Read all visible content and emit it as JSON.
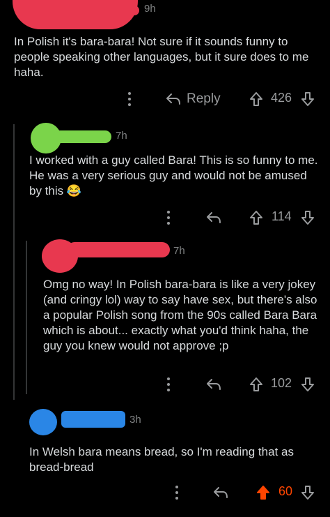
{
  "comments": [
    {
      "time": "9h",
      "body": "In Polish it's bara-bara! Not sure if it sounds funny to people speaking other languages, but it sure does to me haha.",
      "reply_label": "Reply",
      "score": "426",
      "redaction_color": "#e8384f",
      "upvoted": false
    },
    {
      "time": "7h",
      "body": "I worked with a guy called Bara! This is so funny to me. He was a very serious guy and would not be amused by this",
      "emoji": "😂",
      "score": "114",
      "redaction_color": "#7bd44a",
      "upvoted": false
    },
    {
      "time": "7h",
      "body": "Omg no way! In Polish bara-bara is like a very jokey (and cringy lol) way to say have sex, but there's also a popular Polish song from the 90s called Bara Bara which is about... exactly what you'd think haha, the guy you knew would not approve ;p",
      "score": "102",
      "redaction_color": "#e8384f",
      "upvoted": false
    },
    {
      "time": "3h",
      "body": "In Welsh bara means bread, so I'm reading that as bread-bread",
      "score": "60",
      "redaction_color": "#2a86e6",
      "upvoted": true
    }
  ],
  "colors": {
    "background": "#000000",
    "text": "#d7dadc",
    "muted": "#818384",
    "upvote_active": "#ff4500",
    "thread_line": "#343536"
  },
  "icons": [
    "more-vertical-icon",
    "reply-arrow-icon",
    "upvote-arrow-icon",
    "downvote-arrow-icon"
  ]
}
